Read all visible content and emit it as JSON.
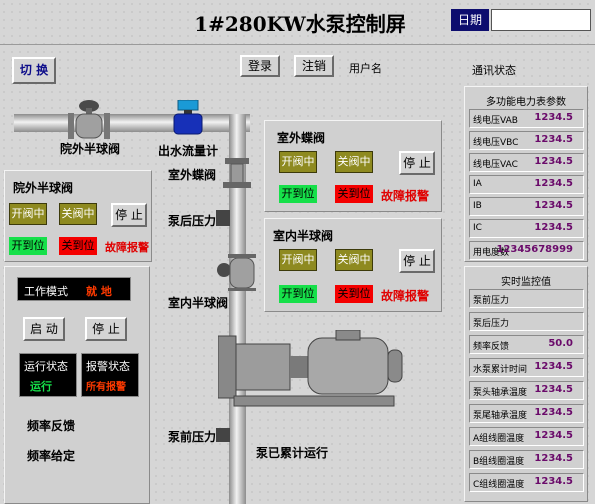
{
  "header": {
    "title": "1#280KW水泵控制屏",
    "date_label": "日期",
    "date_value": ""
  },
  "toolbar": {
    "switch": "切 换",
    "login": "登录",
    "logout": "注销",
    "username_label": "用户名",
    "comm_status": "通讯状态"
  },
  "outdoor_valve": {
    "title": "室外蝶阀",
    "opening": "开阀中",
    "closing": "关阀中",
    "stop": "停 止",
    "opened": "开到位",
    "closed": "关到位",
    "fault": "故障报警"
  },
  "indoor_valve": {
    "title": "室内半球阀",
    "opening": "开阀中",
    "closing": "关阀中",
    "stop": "停 止",
    "opened": "开到位",
    "closed": "关到位",
    "fault": "故障报警"
  },
  "outside_ball_valve": {
    "title": "院外半球阀",
    "opening": "开阀中",
    "closing": "关阀中",
    "stop": "停 止",
    "opened": "开到位",
    "closed": "关到位",
    "fault": "故障报警"
  },
  "diagram_labels": {
    "outside_ball": "院外半球阀",
    "flowmeter": "出水流量计",
    "outdoor_butterfly": "室外蝶阀",
    "post_pressure": "泵后压力",
    "indoor_ball": "室内半球阀",
    "pre_pressure": "泵前压力",
    "runtime": "泵已累计运行"
  },
  "work_panel": {
    "mode_label": "工作模式",
    "mode_value": "就 地",
    "start": "启 动",
    "stop": "停 止",
    "run_label": "运行状态",
    "run_value": "运行",
    "alarm_label": "报警状态",
    "alarm_value": "所有报警",
    "freq_feedback": "频率反馈",
    "freq_setpoint": "频率给定"
  },
  "meter": {
    "title": "多功能电力表参数",
    "rows": [
      {
        "k": "线电压VAB",
        "v": "1234.5"
      },
      {
        "k": "线电压VBC",
        "v": "1234.5"
      },
      {
        "k": "线电压VAC",
        "v": "1234.5"
      },
      {
        "k": "IA",
        "v": "1234.5"
      },
      {
        "k": "IB",
        "v": "1234.5"
      },
      {
        "k": "IC",
        "v": "1234.5"
      },
      {
        "k": "用电度数",
        "v": "12345678999"
      }
    ]
  },
  "realtime": {
    "title": "实时监控值",
    "rows": [
      {
        "k": "泵前压力",
        "v": ""
      },
      {
        "k": "泵后压力",
        "v": ""
      },
      {
        "k": "频率反馈",
        "v": "50.0"
      },
      {
        "k": "水泵累计时间",
        "v": "1234.5"
      },
      {
        "k": "泵头轴承温度",
        "v": "1234.5"
      },
      {
        "k": "泵尾轴承温度",
        "v": "1234.5"
      },
      {
        "k": "A组线圈温度",
        "v": "1234.5"
      },
      {
        "k": "B组线圈温度",
        "v": "1234.5"
      },
      {
        "k": "C组线圈温度",
        "v": "1234.5"
      }
    ]
  },
  "colors": {
    "run_green": "#16e04a",
    "alarm_red": "#f40000",
    "valve_olive": "#8e8a20",
    "title_blue": "#0d0d6e",
    "value_purple": "#6a0a6a"
  }
}
